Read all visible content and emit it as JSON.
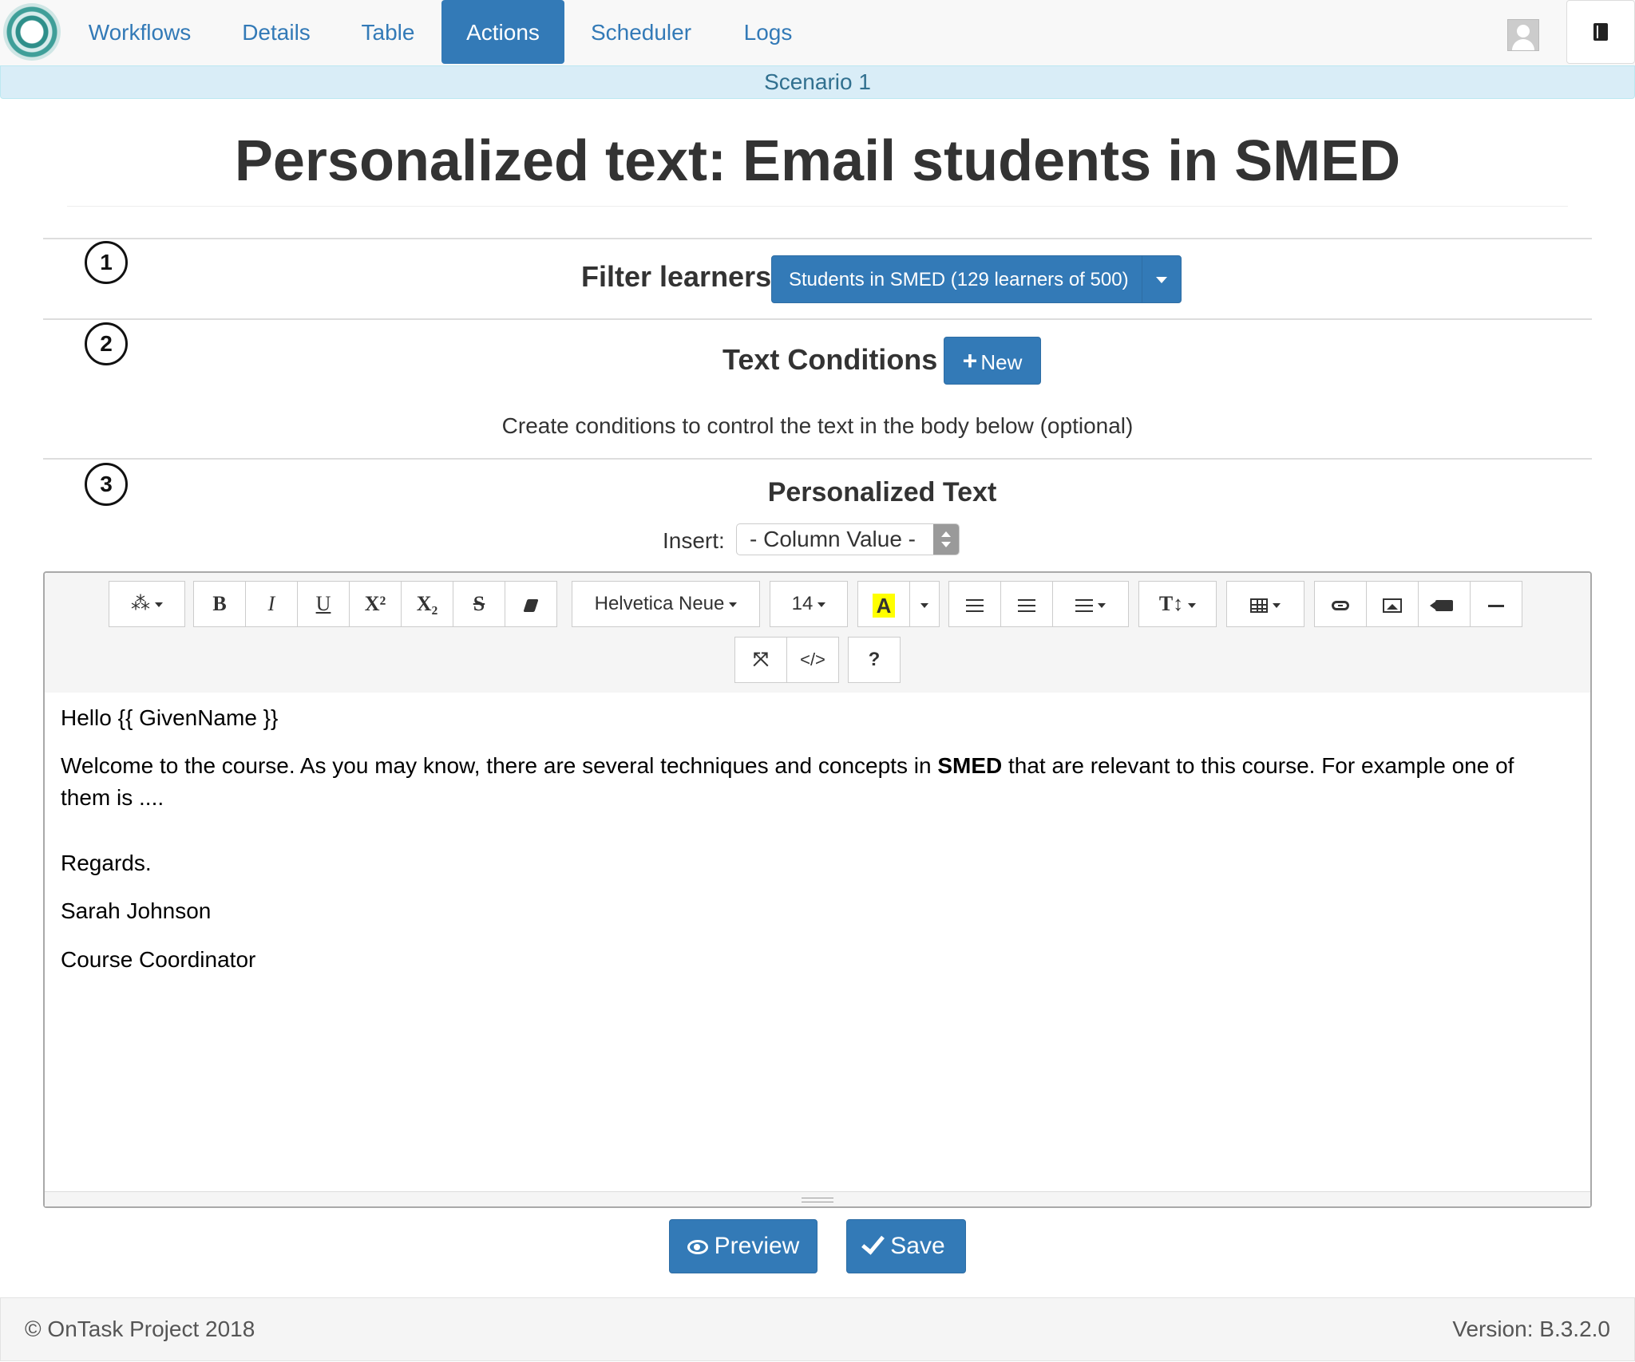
{
  "nav": {
    "items": [
      {
        "label": "Workflows",
        "active": false
      },
      {
        "label": "Details",
        "active": false
      },
      {
        "label": "Table",
        "active": false
      },
      {
        "label": "Actions",
        "active": true
      },
      {
        "label": "Scheduler",
        "active": false
      },
      {
        "label": "Logs",
        "active": false
      }
    ],
    "icons": {
      "logo": "ontask-logo",
      "user": "user-avatar-icon",
      "help": "book-icon"
    }
  },
  "scenario": {
    "label": "Scenario 1"
  },
  "page": {
    "title": "Personalized text: Email students in SMED"
  },
  "steps": {
    "step1": {
      "number": "1"
    },
    "step2": {
      "number": "2"
    },
    "step3": {
      "number": "3"
    }
  },
  "filter": {
    "label": "Filter learners",
    "button": "Students in SMED (129 learners of 500)"
  },
  "conditions": {
    "label": "Text Conditions",
    "new_button": "New",
    "help": "Create conditions to control the text in the body below (optional)"
  },
  "personalized": {
    "label": "Personalized Text",
    "insert_label": "Insert:",
    "insert_value": "- Column Value -"
  },
  "toolbar": {
    "font_name": "Helvetica Neue",
    "font_size": "14",
    "bold": "B",
    "italic": "I",
    "underline": "U",
    "superscript": "X²",
    "subscript": "X₂",
    "strikethrough": "S",
    "color": "A",
    "code_view": "</>",
    "help": "?",
    "text_height": "T↕"
  },
  "body": {
    "greeting": "Hello {{ GivenName }}",
    "para_before": "Welcome to the course. As you may know, there are several techniques and concepts in ",
    "para_bold": "SMED",
    "para_after": " that are relevant to this course. For example one of them is ....",
    "regards": "Regards.",
    "name": "Sarah Johnson",
    "role": "Course Coordinator"
  },
  "buttons": {
    "preview": "Preview",
    "save": "Save"
  },
  "footer": {
    "copyright": "© OnTask Project 2018",
    "version": "Version: B.3.2.0"
  },
  "colors": {
    "primary": "#337ab7",
    "info_bg": "#d9edf7",
    "info_text": "#31708f",
    "highlight": "#ffff00"
  }
}
